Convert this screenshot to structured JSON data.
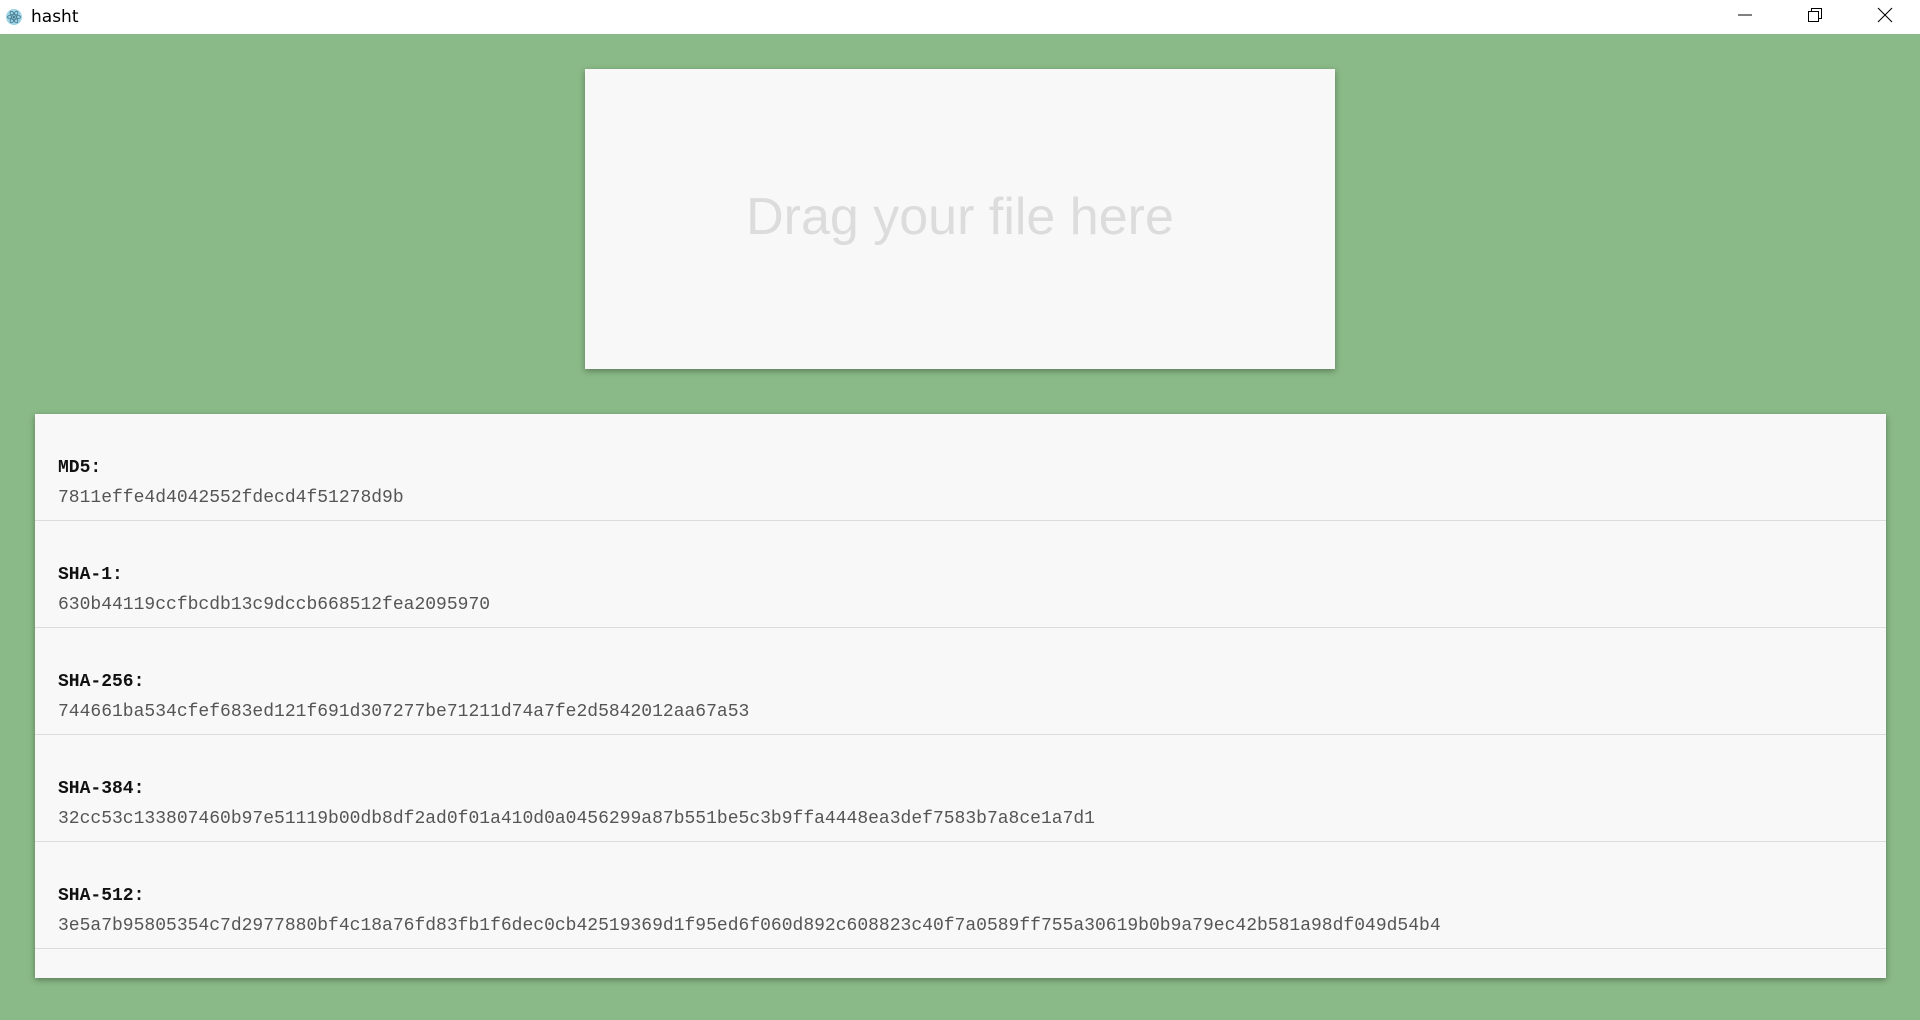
{
  "window": {
    "title": "hasht",
    "app_icon": "atom-icon",
    "controls": [
      "minimize-icon",
      "restore-icon",
      "close-icon"
    ]
  },
  "dropzone": {
    "text": "Drag your file here"
  },
  "hashes": [
    {
      "label": "MD5:",
      "value": "7811effe4d4042552fdecd4f51278d9b"
    },
    {
      "label": "SHA-1:",
      "value": "630b44119ccfbcdb13c9dccb668512fea2095970"
    },
    {
      "label": "SHA-256:",
      "value": "744661ba534cfef683ed121f691d307277be71211d74a7fe2d5842012aa67a53"
    },
    {
      "label": "SHA-384:",
      "value": "32cc53c133807460b97e51119b00db8df2ad0f01a410d0a0456299a87b551be5c3b9ffa4448ea3def7583b7a8ce1a7d1"
    },
    {
      "label": "SHA-512:",
      "value": "3e5a7b95805354c7d2977880bf4c18a76fd83fb1f6dec0cb42519369d1f95ed6f060d892c608823c40f7a0589ff755a30619b0b9a79ec42b581a98df049d54b4"
    }
  ],
  "colors": {
    "background": "#8aba87",
    "panel": "#f8f8f8",
    "dropzone_text": "#dcdcdc"
  }
}
